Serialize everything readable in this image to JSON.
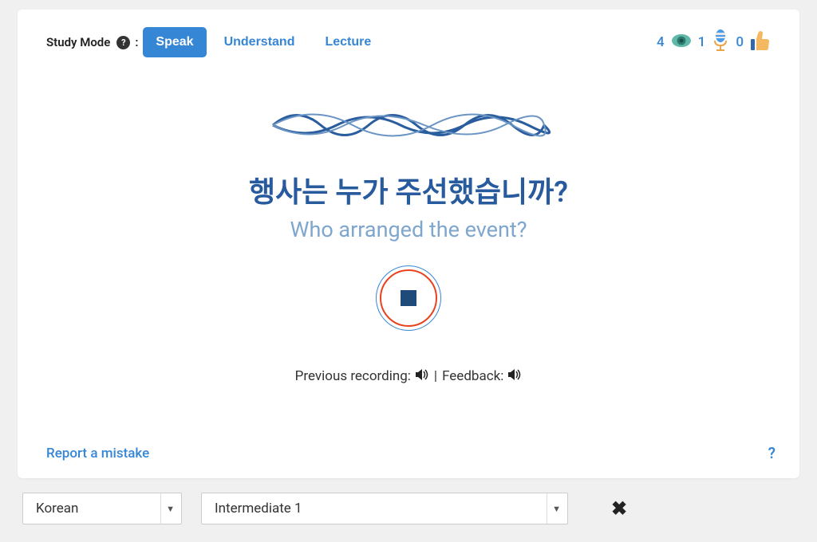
{
  "header": {
    "mode_label": "Study Mode",
    "colon": ":",
    "modes": {
      "speak": "Speak",
      "understand": "Understand",
      "lecture": "Lecture"
    }
  },
  "stats": {
    "views": "4",
    "speaks": "1",
    "likes": "0"
  },
  "content": {
    "target": "행사는 누가 주선했습니까?",
    "translation": "Who arranged the event?"
  },
  "playback": {
    "prev_label": "Previous recording:",
    "sep": " | ",
    "feedback_label": "Feedback:"
  },
  "footer": {
    "report": "Report a mistake",
    "help": "?"
  },
  "bottom": {
    "language": "Korean",
    "level": "Intermediate 1"
  }
}
